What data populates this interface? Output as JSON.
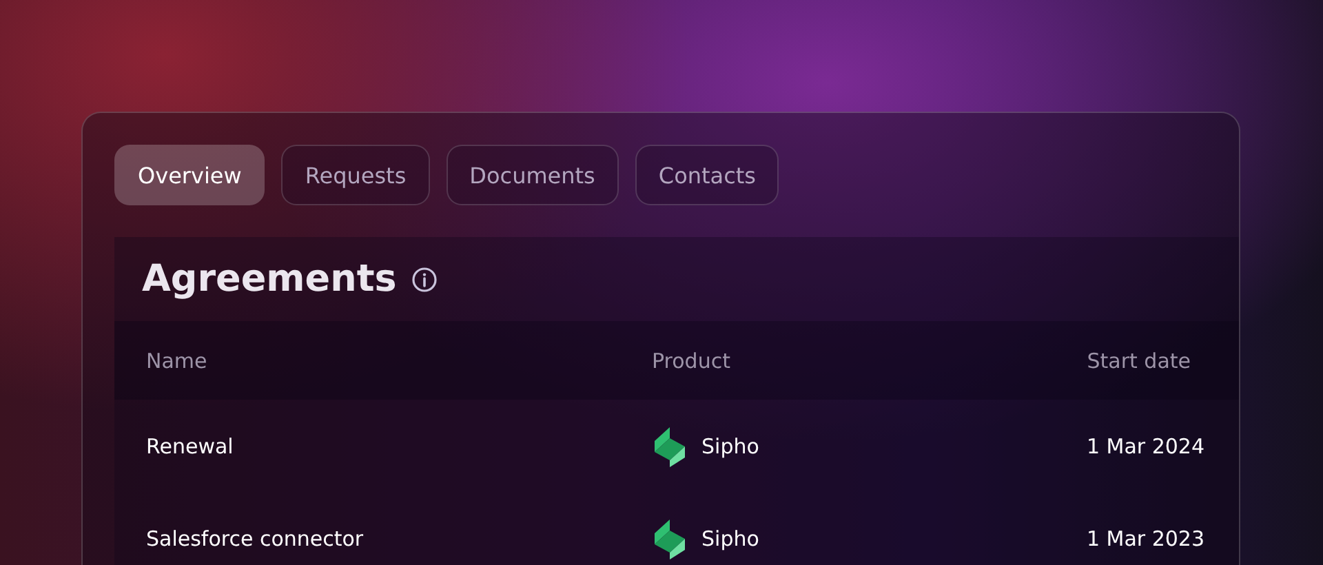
{
  "tabs": [
    {
      "label": "Overview",
      "selected": true
    },
    {
      "label": "Requests",
      "selected": false
    },
    {
      "label": "Documents",
      "selected": false
    },
    {
      "label": "Contacts",
      "selected": false
    }
  ],
  "section": {
    "title": "Agreements"
  },
  "table": {
    "columns": [
      "Name",
      "Product",
      "Start date"
    ],
    "rows": [
      {
        "name": "Renewal",
        "product": "Sipho",
        "start_date": "1 Mar 2024"
      },
      {
        "name": "Salesforce connector",
        "product": "Sipho",
        "start_date": "1 Mar 2023"
      }
    ]
  }
}
